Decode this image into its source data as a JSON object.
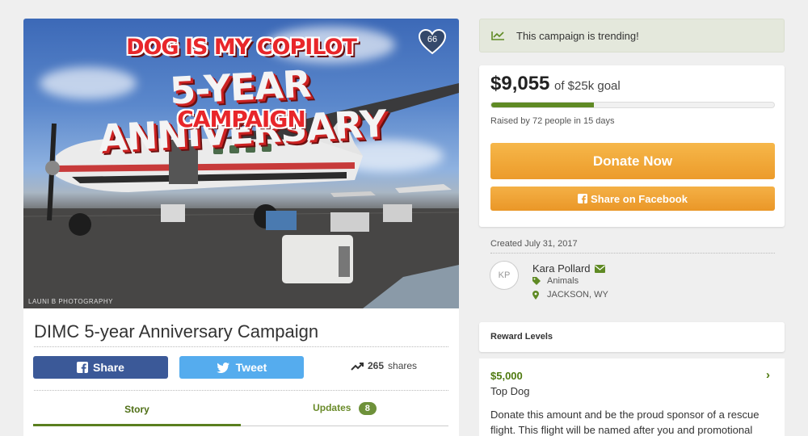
{
  "hero": {
    "title_line1": "DOG IS MY COPILOT",
    "title_line2": "5-YEAR ANNIVERSARY",
    "title_line3": "CAMPAIGN",
    "heart_count": "66",
    "photo_credit": "LAUNI B PHOTOGRAPHY"
  },
  "campaign": {
    "title": "DIMC 5-year Anniversary Campaign",
    "share_label": "Share",
    "tweet_label": "Tweet",
    "shares_count": "265",
    "shares_label": "shares",
    "tabs": [
      {
        "label": "Story"
      },
      {
        "label": "Updates",
        "badge": "8"
      }
    ]
  },
  "trending": {
    "text": "This campaign is trending!"
  },
  "goal": {
    "amount": "$9,055",
    "goal_text": "of $25k goal",
    "progress_fraction": 0.3622,
    "raised_text": "Raised by 72 people in 15 days",
    "donate_label": "Donate Now",
    "fb_label": "Share on Facebook"
  },
  "organizer": {
    "created": "Created July 31, 2017",
    "initials": "KP",
    "name": "Kara Pollard",
    "category": "Animals",
    "location": "JACKSON, WY"
  },
  "rewards": {
    "header": "Reward Levels",
    "items": [
      {
        "amount": "$5,000",
        "name": "Top Dog",
        "description": "Donate this amount and be the proud sponsor of a rescue flight. This flight will be named after you and promotional"
      }
    ]
  },
  "colors": {
    "accent_green": "#5f8a24",
    "donate_orange": "#ec9b2a",
    "facebook_blue": "#3b5998",
    "twitter_blue": "#55acee"
  }
}
